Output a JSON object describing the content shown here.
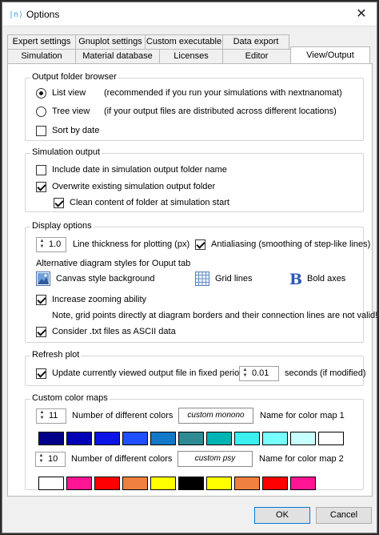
{
  "window": {
    "title": "Options",
    "app_icon_text": "|n⟩"
  },
  "tabs_back": [
    "Expert settings",
    "Gnuplot settings",
    "Custom executable",
    "Data export"
  ],
  "tabs_front": [
    "Simulation",
    "Material database",
    "Licenses",
    "Editor",
    "View/Output"
  ],
  "active_tab": "View/Output",
  "output_folder": {
    "title": "Output folder browser",
    "list_view": "List view",
    "list_view_note": "(recommended if you run your simulations with nextnanomat)",
    "tree_view": "Tree view",
    "tree_view_note": "(if your output files are distributed across different locations)",
    "sort_by_date": "Sort by date"
  },
  "simulation_output": {
    "title": "Simulation output",
    "include_date": "Include date in simulation output folder name",
    "overwrite": "Overwrite existing simulation output folder",
    "clean": "Clean content of folder at simulation start"
  },
  "display": {
    "title": "Display options",
    "line_thickness_value": "1.0",
    "line_thickness_label": "Line thickness for plotting (px)",
    "antialiasing": "Antialiasing (smoothing of step-like lines)",
    "alt_styles": "Alternative diagram styles for Ouput tab",
    "canvas_style": "Canvas style background",
    "grid_lines": "Grid lines",
    "bold_axes": "Bold axes",
    "bold_axes_glyph": "B",
    "zooming": "Increase zooming ability",
    "note": "Note, grid points directly at diagram borders and their connection lines are not valid!",
    "ascii": "Consider .txt files as ASCII data"
  },
  "refresh": {
    "title": "Refresh plot",
    "update_label": "Update currently viewed output file in fixed period of",
    "period_value": "0.01",
    "seconds_label": "seconds (if modified)"
  },
  "colormaps": {
    "title": "Custom color maps",
    "map1_count": "11",
    "map1_count_label": "Number of different colors",
    "map1_name": "custom monono",
    "map1_name_label": "Name for color map 1",
    "map1_colors": [
      "#00008b",
      "#0000b4",
      "#0a14e6",
      "#1e50ff",
      "#1478c8",
      "#2e8b94",
      "#00b4b4",
      "#3cf0f0",
      "#78ffff",
      "#c8ffff",
      "#ffffff"
    ],
    "map2_count": "10",
    "map2_count_label": "Number of different colors",
    "map2_name": "custom psy",
    "map2_name_label": "Name for color map 2",
    "map2_colors": [
      "#ffffff",
      "#ff1493",
      "#ff0000",
      "#f08040",
      "#ffff00",
      "#000000",
      "#ffff00",
      "#f08040",
      "#ff0000",
      "#ff1493"
    ]
  },
  "buttons": {
    "ok": "OK",
    "cancel": "Cancel"
  }
}
